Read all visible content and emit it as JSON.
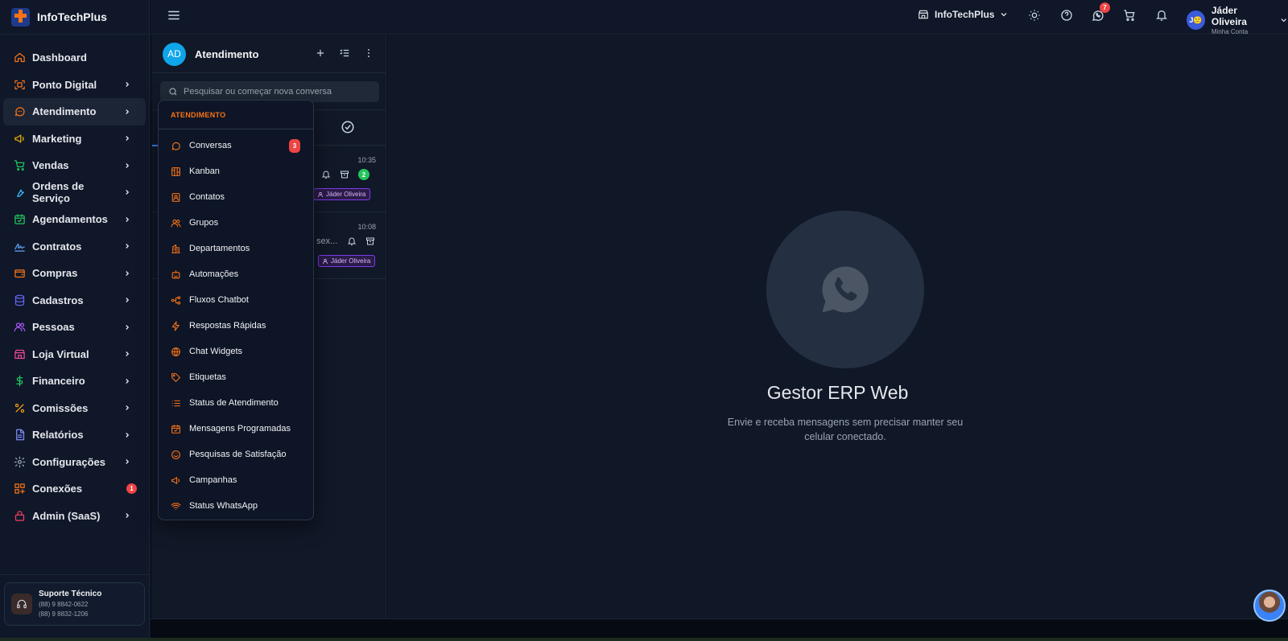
{
  "brand": {
    "name": "InfoTechPlus"
  },
  "sidebar": {
    "items": [
      {
        "label": "Dashboard",
        "icon": "home-icon",
        "color": "#f97316",
        "chevron": false
      },
      {
        "label": "Ponto Digital",
        "icon": "scan-icon",
        "color": "#f97316",
        "chevron": true
      },
      {
        "label": "Atendimento",
        "icon": "chat-icon",
        "color": "#f97316",
        "chevron": true,
        "active": true
      },
      {
        "label": "Marketing",
        "icon": "megaphone-icon",
        "color": "#eab308",
        "chevron": true
      },
      {
        "label": "Vendas",
        "icon": "cart-icon",
        "color": "#22c55e",
        "chevron": true
      },
      {
        "label": "Ordens de Serviço",
        "icon": "wrench-icon",
        "color": "#38bdf8",
        "chevron": true
      },
      {
        "label": "Agendamentos",
        "icon": "calendar-icon",
        "color": "#22c55e",
        "chevron": true
      },
      {
        "label": "Contratos",
        "icon": "signature-icon",
        "color": "#60a5fa",
        "chevron": true
      },
      {
        "label": "Compras",
        "icon": "wallet-icon",
        "color": "#f97316",
        "chevron": true
      },
      {
        "label": "Cadastros",
        "icon": "database-icon",
        "color": "#6366f1",
        "chevron": true
      },
      {
        "label": "Pessoas",
        "icon": "users-icon",
        "color": "#a855f7",
        "chevron": true
      },
      {
        "label": "Loja Virtual",
        "icon": "store-icon",
        "color": "#ec4899",
        "chevron": true
      },
      {
        "label": "Financeiro",
        "icon": "dollar-icon",
        "color": "#22c55e",
        "chevron": true
      },
      {
        "label": "Comissões",
        "icon": "percent-icon",
        "color": "#f59e0b",
        "chevron": true
      },
      {
        "label": "Relatórios",
        "icon": "file-icon",
        "color": "#818cf8",
        "chevron": true
      },
      {
        "label": "Configurações",
        "icon": "gear-icon",
        "color": "#9ca3af",
        "chevron": true
      },
      {
        "label": "Conexões",
        "icon": "grid-icon",
        "color": "#f97316",
        "chevron": false,
        "badge": "1"
      },
      {
        "label": "Admin (SaaS)",
        "icon": "lock-icon",
        "color": "#f43f5e",
        "chevron": true
      }
    ],
    "support": {
      "title": "Suporte Técnico",
      "phone1": "(88) 9 8842-0622",
      "phone2": "(88) 9 8832-1206"
    }
  },
  "topbar": {
    "company": "InfoTechPlus",
    "whatsapp_badge": "7",
    "user": {
      "initials": "J🙂",
      "name": "Jáder Oliveira",
      "subtitle": "Minha Conta"
    }
  },
  "chat": {
    "avatar": "AD",
    "title": "Atendimento",
    "search_placeholder": "Pesquisar ou começar nova conversa",
    "conversations": [
      {
        "time": "10:35",
        "snippet": "",
        "unread": "2",
        "agent": "Jáder Oliveira"
      },
      {
        "time": "10:08",
        "snippet": "sex...",
        "unread": "",
        "agent": "Jáder Oliveira"
      }
    ]
  },
  "dropdown": {
    "header": "ATENDIMENTO",
    "items": [
      {
        "label": "Conversas",
        "icon": "chat-bubble-icon",
        "badge": "3"
      },
      {
        "label": "Kanban",
        "icon": "kanban-icon"
      },
      {
        "label": "Contatos",
        "icon": "contact-card-icon"
      },
      {
        "label": "Grupos",
        "icon": "group-icon"
      },
      {
        "label": "Departamentos",
        "icon": "building-icon"
      },
      {
        "label": "Automações",
        "icon": "bot-icon"
      },
      {
        "label": "Fluxos Chatbot",
        "icon": "flow-icon"
      },
      {
        "label": "Respostas Rápidas",
        "icon": "bolt-icon"
      },
      {
        "label": "Chat Widgets",
        "icon": "globe-icon"
      },
      {
        "label": "Etiquetas",
        "icon": "tag-icon"
      },
      {
        "label": "Status de Atendimento",
        "icon": "list-status-icon"
      },
      {
        "label": "Mensagens Programadas",
        "icon": "calendar-check-icon"
      },
      {
        "label": "Pesquisas de Satisfação",
        "icon": "smile-icon"
      },
      {
        "label": "Campanhas",
        "icon": "megaphone-icon"
      },
      {
        "label": "Status WhatsApp",
        "icon": "wifi-icon"
      }
    ]
  },
  "main": {
    "title": "Gestor ERP Web",
    "subtitle": "Envie e receba mensagens sem precisar manter seu celular conectado."
  },
  "colors": {
    "accent": "#f97316",
    "danger": "#ef4444",
    "success": "#22c55e"
  }
}
